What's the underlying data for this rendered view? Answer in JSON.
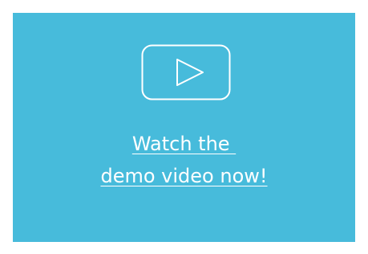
{
  "card": {
    "background_color": "#47bbdb",
    "foreground_color": "#ffffff"
  },
  "play_button": {
    "icon": "play-icon"
  },
  "cta": {
    "line1": "Watch the ",
    "line2": "demo video now!"
  }
}
